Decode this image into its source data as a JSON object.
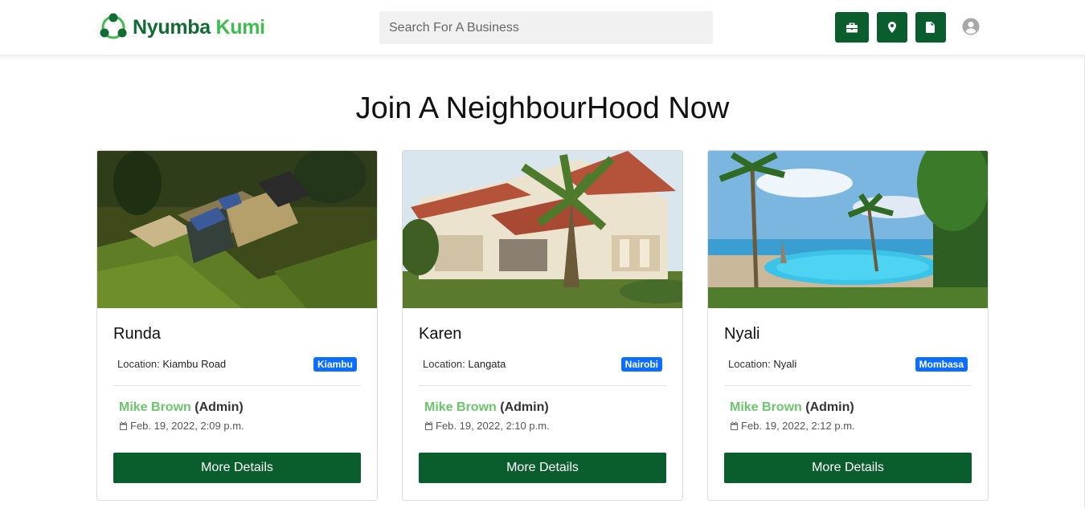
{
  "brand": {
    "part1": "Nyumba",
    "part2": "Kumi"
  },
  "search": {
    "placeholder": "Search For A Business"
  },
  "nav": {
    "icons": [
      "briefcase-icon",
      "map-pin-icon",
      "file-icon",
      "user-avatar-icon"
    ]
  },
  "page": {
    "heading": "Join A NeighbourHood Now"
  },
  "colors": {
    "primary": "#0a5d2c",
    "accent": "#6cc56b",
    "badge": "#0d6efd"
  },
  "cards": [
    {
      "title": "Runda",
      "location_label": "Location:",
      "location": "Kiambu Road",
      "county": "Kiambu",
      "admin_name": "Mike Brown",
      "admin_role": "(Admin)",
      "date": "Feb. 19, 2022, 2:09 p.m.",
      "button": "More Details"
    },
    {
      "title": "Karen",
      "location_label": "Location:",
      "location": "Langata",
      "county": "Nairobi",
      "admin_name": "Mike Brown",
      "admin_role": "(Admin)",
      "date": "Feb. 19, 2022, 2:10 p.m.",
      "button": "More Details"
    },
    {
      "title": "Nyali",
      "location_label": "Location:",
      "location": "Nyali",
      "county": "Mombasa",
      "admin_name": "Mike Brown",
      "admin_role": "(Admin)",
      "date": "Feb. 19, 2022, 2:12 p.m.",
      "button": "More Details"
    }
  ]
}
